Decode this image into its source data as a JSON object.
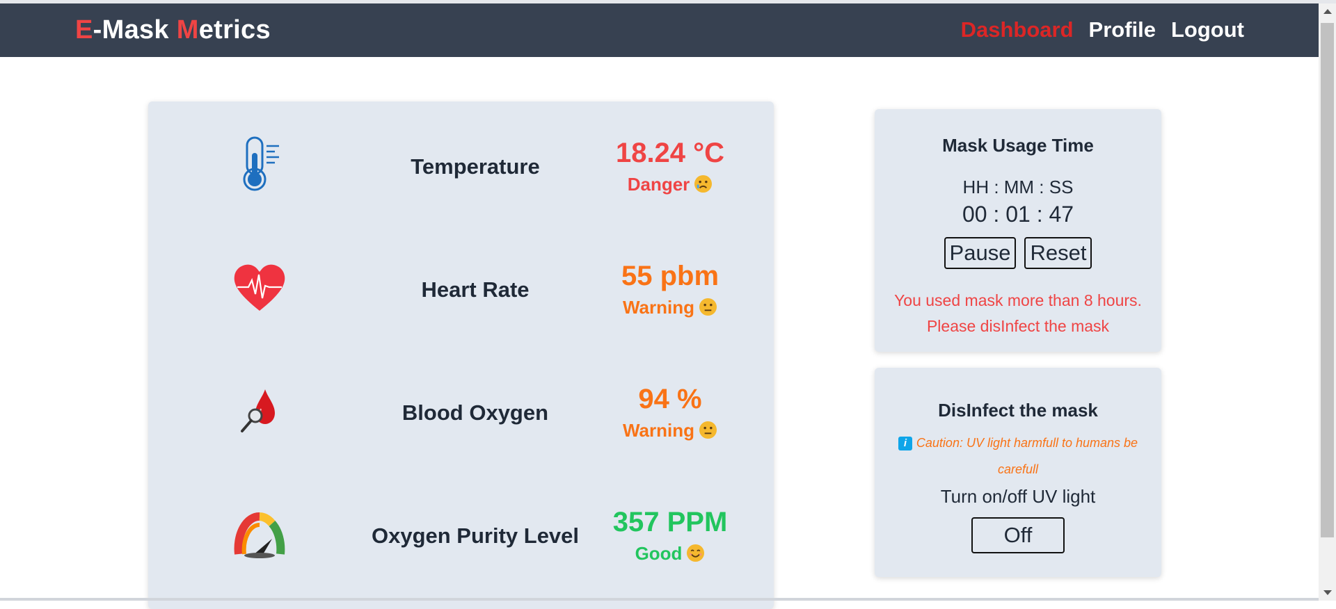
{
  "navbar": {
    "brand_first_letter": "E",
    "brand_part1": "-Mask ",
    "brand_second_letter": "M",
    "brand_part2": "etrics",
    "links": [
      {
        "label": "Dashboard",
        "active": true
      },
      {
        "label": "Profile",
        "active": false
      },
      {
        "label": "Logout",
        "active": false
      }
    ]
  },
  "sensors": [
    {
      "icon": "thermometer-icon",
      "label": "Temperature",
      "value": "18.24 °C",
      "status": "Danger",
      "status_level": "danger",
      "emoji": "sad-emoji-icon"
    },
    {
      "icon": "heart-rate-icon",
      "label": "Heart Rate",
      "value": "55 pbm",
      "status": "Warning",
      "status_level": "warning",
      "emoji": "neutral-emoji-icon"
    },
    {
      "icon": "blood-drop-icon",
      "label": "Blood Oxygen",
      "value": "94 %",
      "status": "Warning",
      "status_level": "warning",
      "emoji": "neutral-emoji-icon"
    },
    {
      "icon": "gauge-icon",
      "label": "Oxygen Purity Level",
      "value": "357 PPM",
      "status": "Good",
      "status_level": "good",
      "emoji": "smile-emoji-icon"
    }
  ],
  "usage": {
    "title": "Mask Usage Time",
    "format": "HH : MM : SS",
    "time": "00 : 01 : 47",
    "pause_label": "Pause",
    "reset_label": "Reset",
    "message_line1": "You used mask more than 8 hours.",
    "message_line2": "Please disInfect the mask"
  },
  "disinfect": {
    "title": "DisInfect the mask",
    "caution": "Caution: UV light harmfull to humans be carefull",
    "uv_label": "Turn on/off UV light",
    "uv_button": "Off"
  },
  "colors": {
    "navbar": "#374151",
    "danger": "#ef4444",
    "warning": "#f97316",
    "good": "#22c55e",
    "card": "#e2e8f0"
  }
}
